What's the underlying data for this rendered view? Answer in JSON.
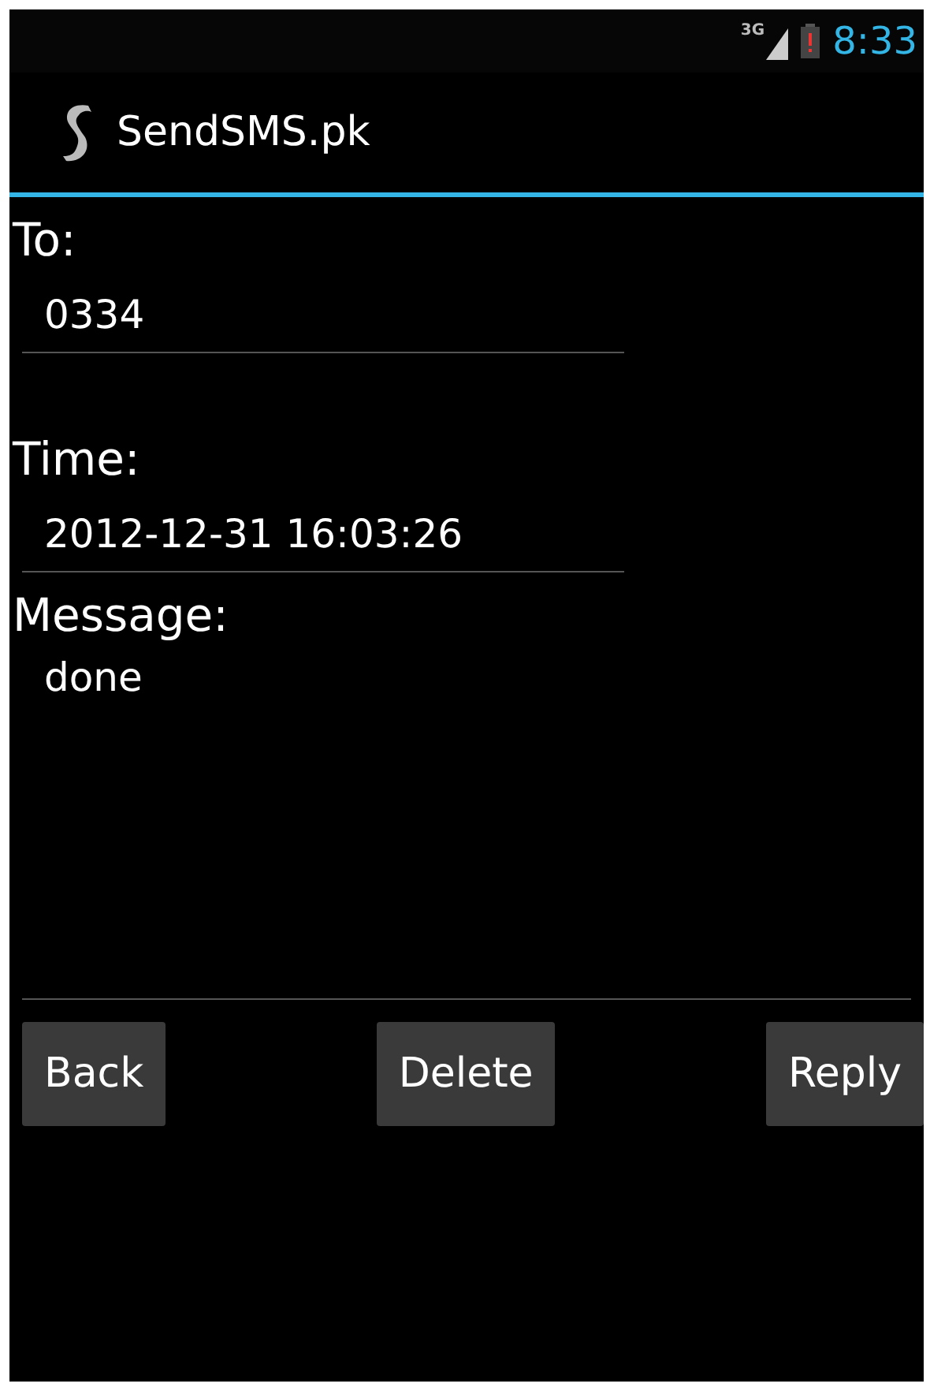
{
  "status_bar": {
    "network": "3G",
    "time": "8:33"
  },
  "action_bar": {
    "title": "SendSMS.pk"
  },
  "fields": [
    {
      "label": "To:",
      "value": "0334"
    },
    {
      "label": "Time:",
      "value": "2012-12-31 16:03:26"
    }
  ],
  "message": {
    "label": "Message:",
    "value": "done"
  },
  "buttons": [
    "Back",
    "Delete",
    "Reply"
  ]
}
